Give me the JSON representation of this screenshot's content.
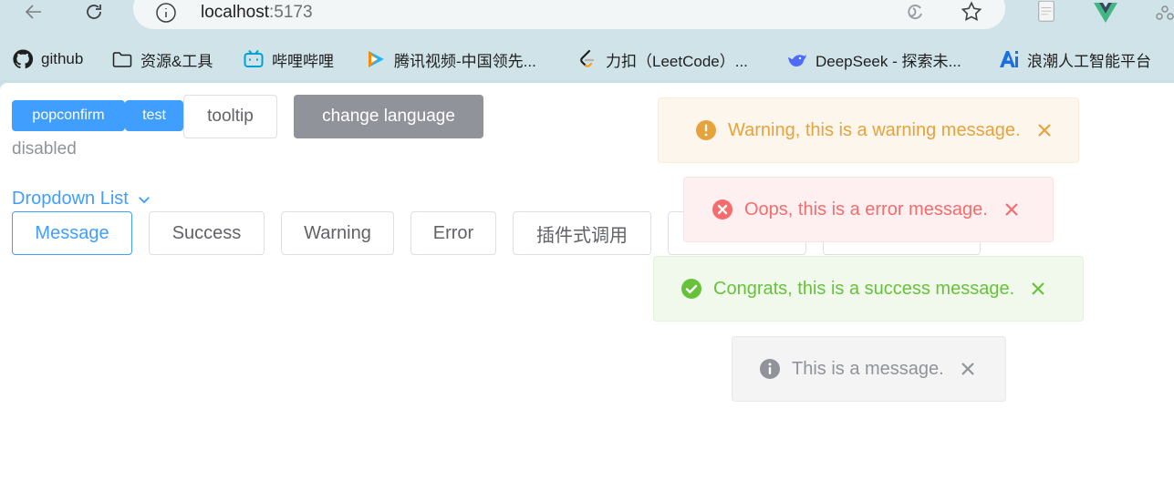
{
  "browser": {
    "url_host": "localhost",
    "url_port": ":5173",
    "bookmarks": [
      {
        "label": "github",
        "icon": "github-icon"
      },
      {
        "label": "资源&工具",
        "icon": "folder-icon"
      },
      {
        "label": "哔哩哔哩",
        "icon": "bilibili-icon"
      },
      {
        "label": "腾讯视频-中国领先...",
        "icon": "tencent-video-icon"
      },
      {
        "label": "力扣（LeetCode）...",
        "icon": "leetcode-icon"
      },
      {
        "label": "DeepSeek - 探索未...",
        "icon": "deepseek-icon"
      },
      {
        "label": "浪潮人工智能平台",
        "icon": "ai-icon"
      }
    ]
  },
  "page": {
    "popconfirm_label": "popconfirm",
    "test_label": "test",
    "tooltip_label": "tooltip",
    "change_language_label": "change language",
    "disabled_label": "disabled",
    "dropdown_label": "Dropdown List",
    "buttons": [
      "Message",
      "Success",
      "Warning",
      "Error",
      "插件式调用"
    ]
  },
  "messages": {
    "warning": "Warning, this is a warning message.",
    "error": "Oops, this is a error message.",
    "success": "Congrats, this is a success message.",
    "info": "This is a message."
  },
  "colors": {
    "primary": "#409eff",
    "warning": "#e6a23c",
    "error": "#f56c6c",
    "success": "#67c23a",
    "info": "#909399"
  }
}
